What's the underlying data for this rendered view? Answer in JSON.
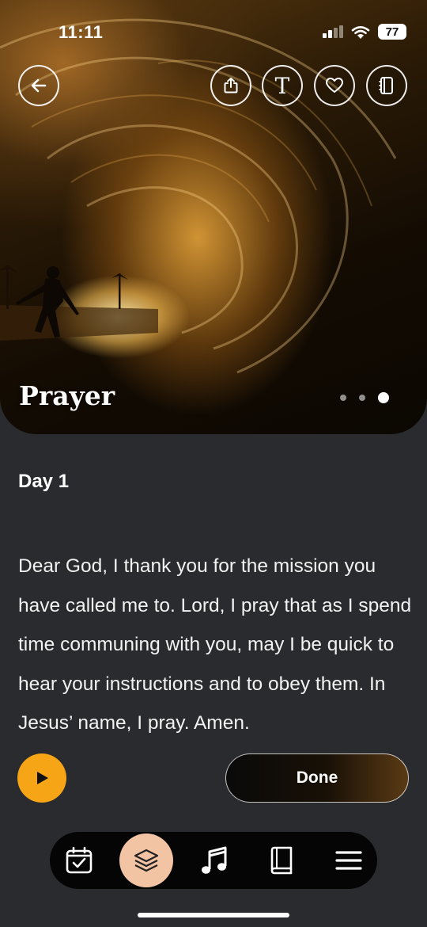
{
  "status_bar": {
    "time": "11:11",
    "battery": "77"
  },
  "hero": {
    "title": "Prayer",
    "carousel": {
      "count": 3,
      "active_index": 2
    }
  },
  "header_buttons": {
    "back": "arrow-left-icon",
    "share": "share-icon",
    "text_size": "T",
    "favorite": "heart-icon",
    "journal": "notebook-icon"
  },
  "content": {
    "day_label": "Day 1",
    "prayer_text": "Dear God, I thank you for the mission you have called me to. Lord, I pray that as I spend time communing with you, may I be quick to hear your instructions and to obey them. In Jesus’ name, I pray. Amen."
  },
  "actions": {
    "done_label": "Done",
    "play": "play-icon"
  },
  "tab_bar": {
    "items": [
      "calendar-check-icon",
      "layers-icon",
      "music-note-icon",
      "book-icon",
      "menu-icon"
    ],
    "active": "layers-icon"
  },
  "colors": {
    "background": "#2a2b2e",
    "play_button": "#f5a515",
    "active_tab_bubble": "#f3c4a4"
  }
}
